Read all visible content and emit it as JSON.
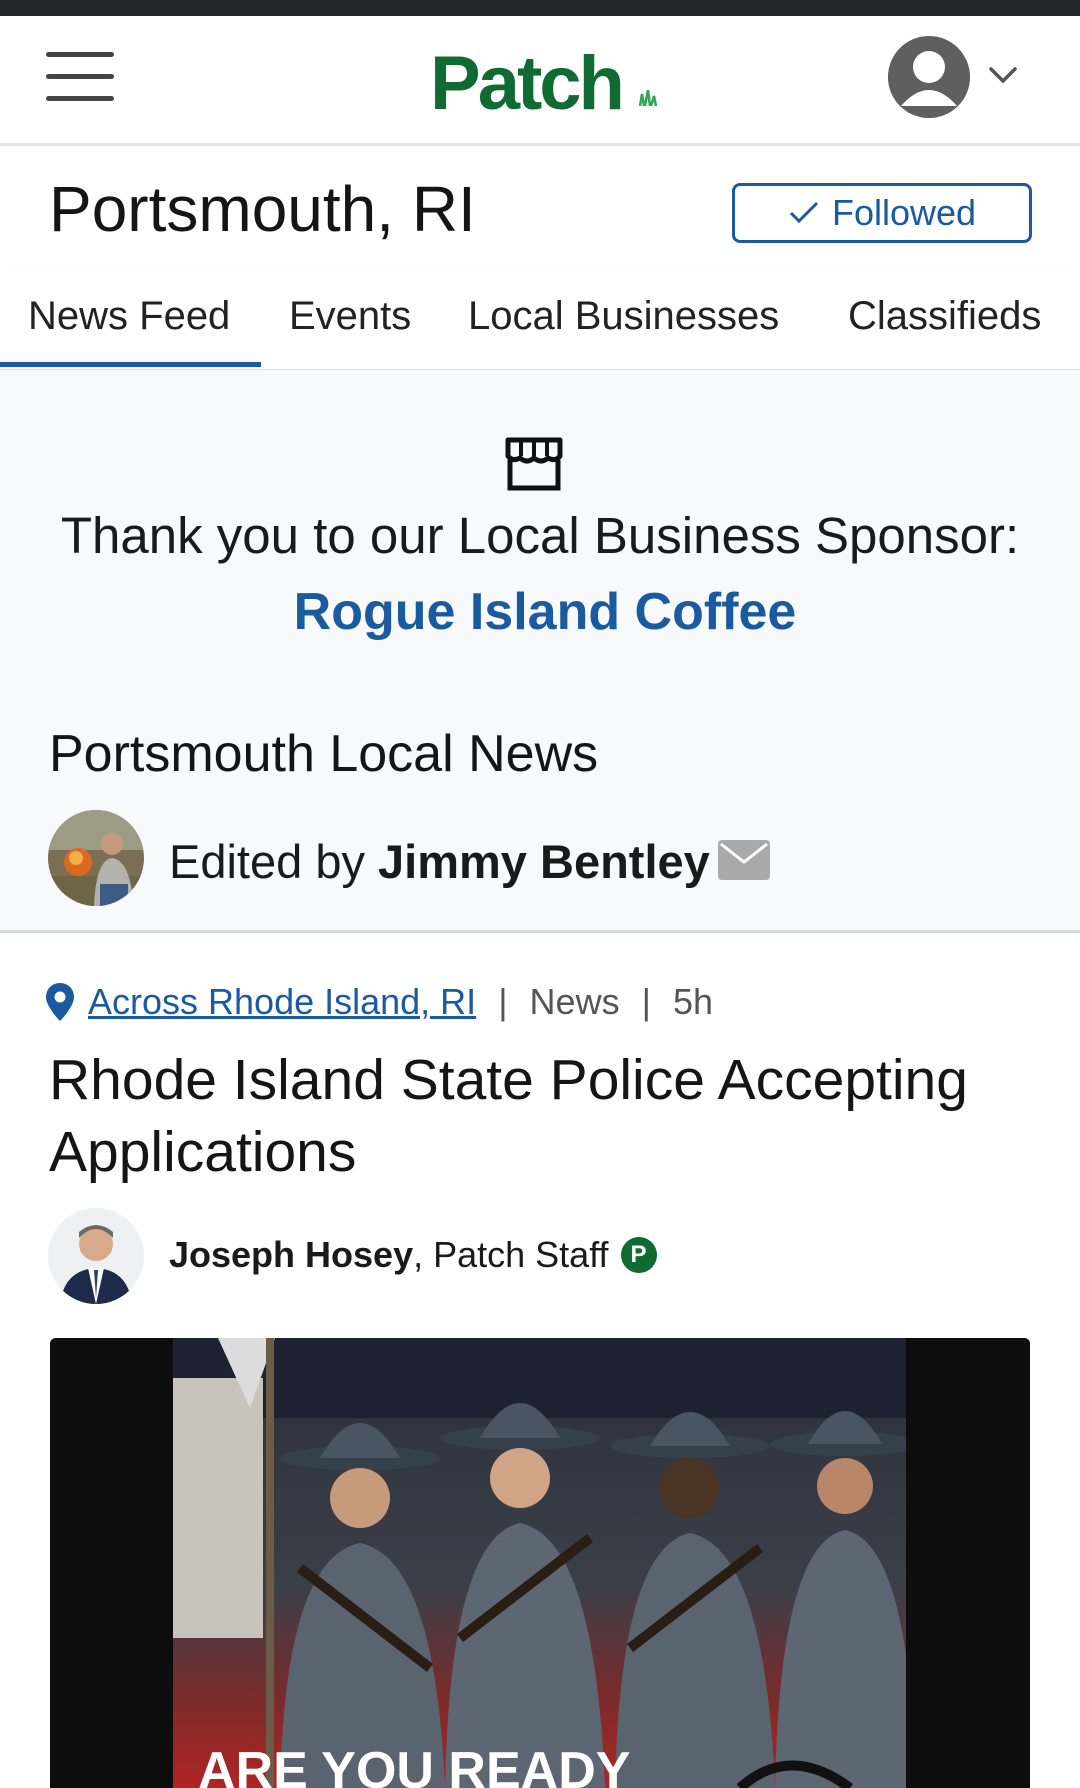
{
  "header": {
    "logo_text": "Patch",
    "menu_icon": "hamburger-icon",
    "account_icon": "user-avatar-icon",
    "account_chevron": "chevron-down-icon"
  },
  "location": {
    "title": "Portsmouth, RI",
    "follow_label": "Followed",
    "follow_icon": "checkmark-icon"
  },
  "tabs": [
    {
      "label": "News Feed",
      "active": true
    },
    {
      "label": "Events",
      "active": false
    },
    {
      "label": "Local Businesses",
      "active": false
    },
    {
      "label": "Classifieds",
      "active": false
    }
  ],
  "sponsor": {
    "icon": "storefront-icon",
    "text": "Thank you to our Local Business Sponsor:",
    "business_name": "Rogue Island Coffee"
  },
  "local_news": {
    "title": "Portsmouth Local News",
    "edited_by_prefix": "Edited by",
    "editor_name": "Jimmy Bentley",
    "mail_icon": "mail-icon"
  },
  "article": {
    "location": "Across Rhode Island, RI",
    "category": "News",
    "age": "5h",
    "headline": "Rhode Island State Police Accepting Applications",
    "author_name": "Joseph Hosey",
    "author_role": "Patch Staff",
    "badge": "P",
    "image_caption": "ARE YOU READY"
  },
  "colors": {
    "brand_green": "#0f6b32",
    "link_blue": "#1a5aa0",
    "status_bar": "#23272d",
    "sponsor_bg": "#f8f9fa"
  }
}
